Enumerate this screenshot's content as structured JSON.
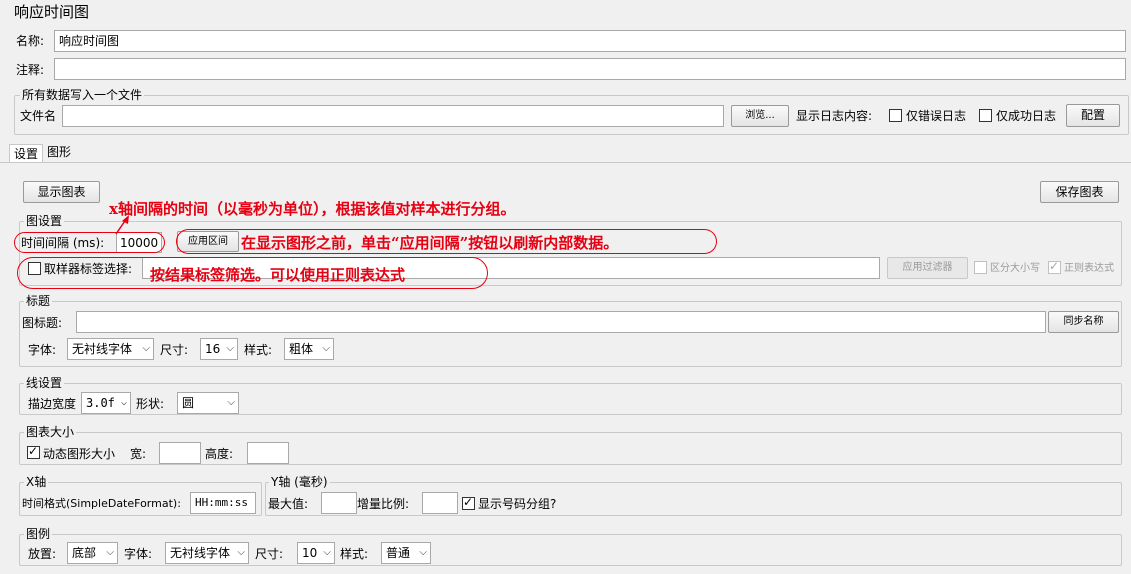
{
  "page": {
    "title": "响应时间图"
  },
  "form": {
    "name_label": "名称:",
    "name_value": "响应时间图",
    "comment_label": "注释:"
  },
  "file_section": {
    "title": "所有数据写入一个文件",
    "filename_label": "文件名",
    "browse_button": "浏览...",
    "log_label": "显示日志内容:",
    "errors_only": "仅错误日志",
    "success_only": "仅成功日志",
    "config_button": "配置"
  },
  "tabs": [
    {
      "label": "设置"
    },
    {
      "label": "图形"
    }
  ],
  "toolbar": {
    "show_chart_button": "显示图表",
    "save_chart_button": "保存图表"
  },
  "chart_settings": {
    "title": "图设置",
    "interval_label": "时间间隔 (ms):",
    "interval_value": "10000",
    "apply_interval_button": "应用区间",
    "sampler_label": "取样器标签选择:",
    "apply_filter_button": "应用过滤器",
    "case_sensitive": "区分大小写",
    "regex": "正则表达式",
    "regex_checked": true
  },
  "title_section": {
    "title": "标题",
    "chart_title_label": "图标题:",
    "sync_name_button": "同步名称",
    "font_label": "字体:",
    "font_value": "无衬线字体",
    "size_label": "尺寸:",
    "size_value": "16",
    "style_label": "样式:",
    "style_value": "粗体"
  },
  "line_section": {
    "title": "线设置",
    "stroke_label": "描边宽度",
    "stroke_value": "3.0f",
    "shape_label": "形状:",
    "shape_value": "圆"
  },
  "size_section": {
    "title": "图表大小",
    "dynamic_label": "动态图形大小",
    "dynamic_checked": true,
    "width_label": "宽:",
    "height_label": "高度:"
  },
  "x_axis": {
    "title": "X轴",
    "format_label": "时间格式(SimpleDateFormat):",
    "format_value": "HH:mm:ss"
  },
  "y_axis": {
    "title": "Y轴 (毫秒)",
    "max_label": "最大值:",
    "increment_label": "增量比例:",
    "grouping_label": "显示号码分组?",
    "grouping_checked": true
  },
  "legend": {
    "title": "图例",
    "placement_label": "放置:",
    "placement_value": "底部",
    "font_label": "字体:",
    "font_value": "无衬线字体",
    "size_label": "尺寸:",
    "size_value": "10",
    "style_label": "样式:",
    "style_value": "普通"
  },
  "annotations": {
    "interval_note": "x轴间隔的时间（以毫秒为单位），根据该值对样本进行分组。",
    "apply_note": "在显示图形之前，单击“应用间隔”按钮以刷新内部数据。",
    "filter_note": "按结果标签筛选。可以使用正则表达式"
  },
  "colors": {
    "annotation": "#e60012",
    "background": "#f0f0f0"
  }
}
